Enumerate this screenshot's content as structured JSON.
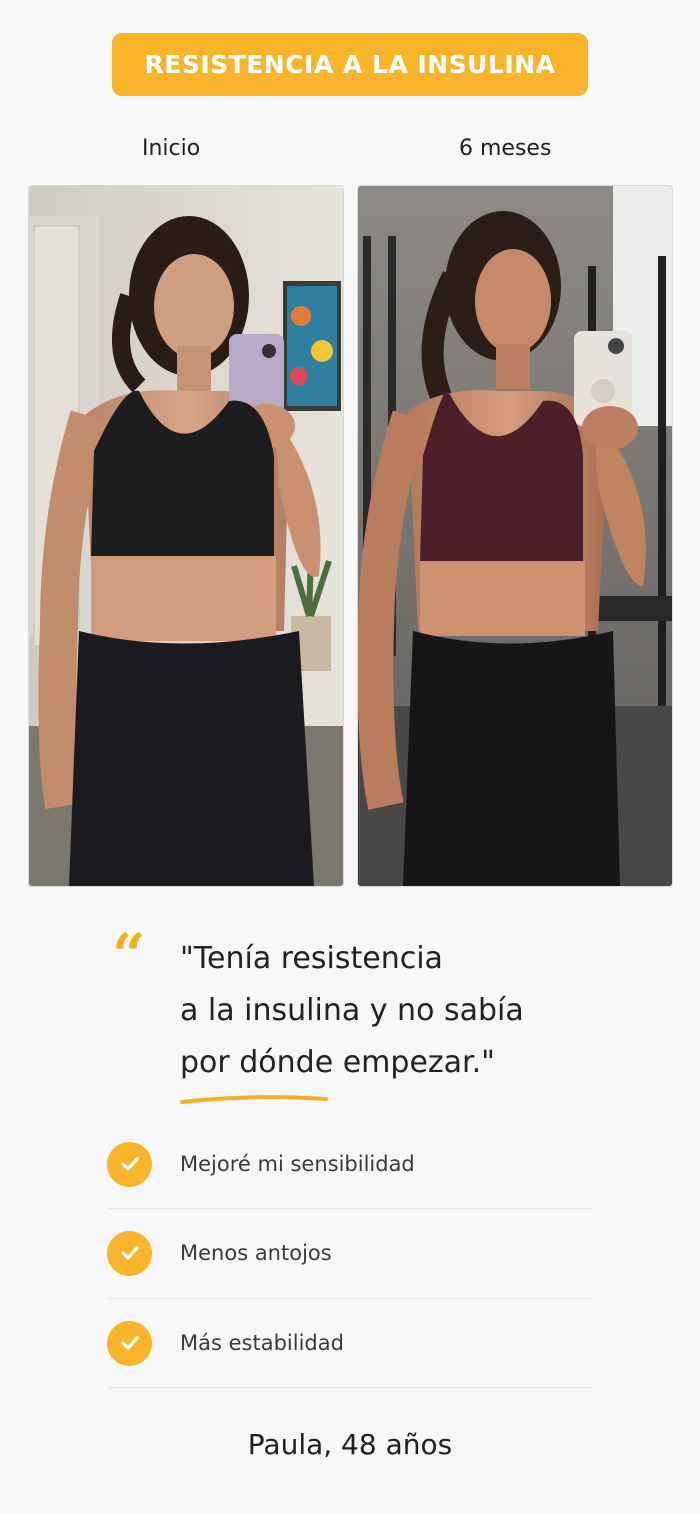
{
  "header": {
    "badge_label": "RESISTENCIA A LA INSULINA",
    "badge_color": "#f6b52a"
  },
  "comparison": {
    "before_label": "Inicio",
    "after_label": "6 meses"
  },
  "testimonial": {
    "quote_lines": [
      "\"Tenía resistencia",
      "a la insulina y no sabía",
      "por dónde empezar.\""
    ],
    "accent_color": "#f1b21f"
  },
  "benefits": [
    {
      "label": "Mejoré mi sensibilidad",
      "icon": "check-icon"
    },
    {
      "label": "Menos antojos",
      "icon": "check-icon"
    },
    {
      "label": "Más estabilidad",
      "icon": "check-icon"
    }
  ],
  "author": {
    "label": "Paula, 48 años"
  }
}
